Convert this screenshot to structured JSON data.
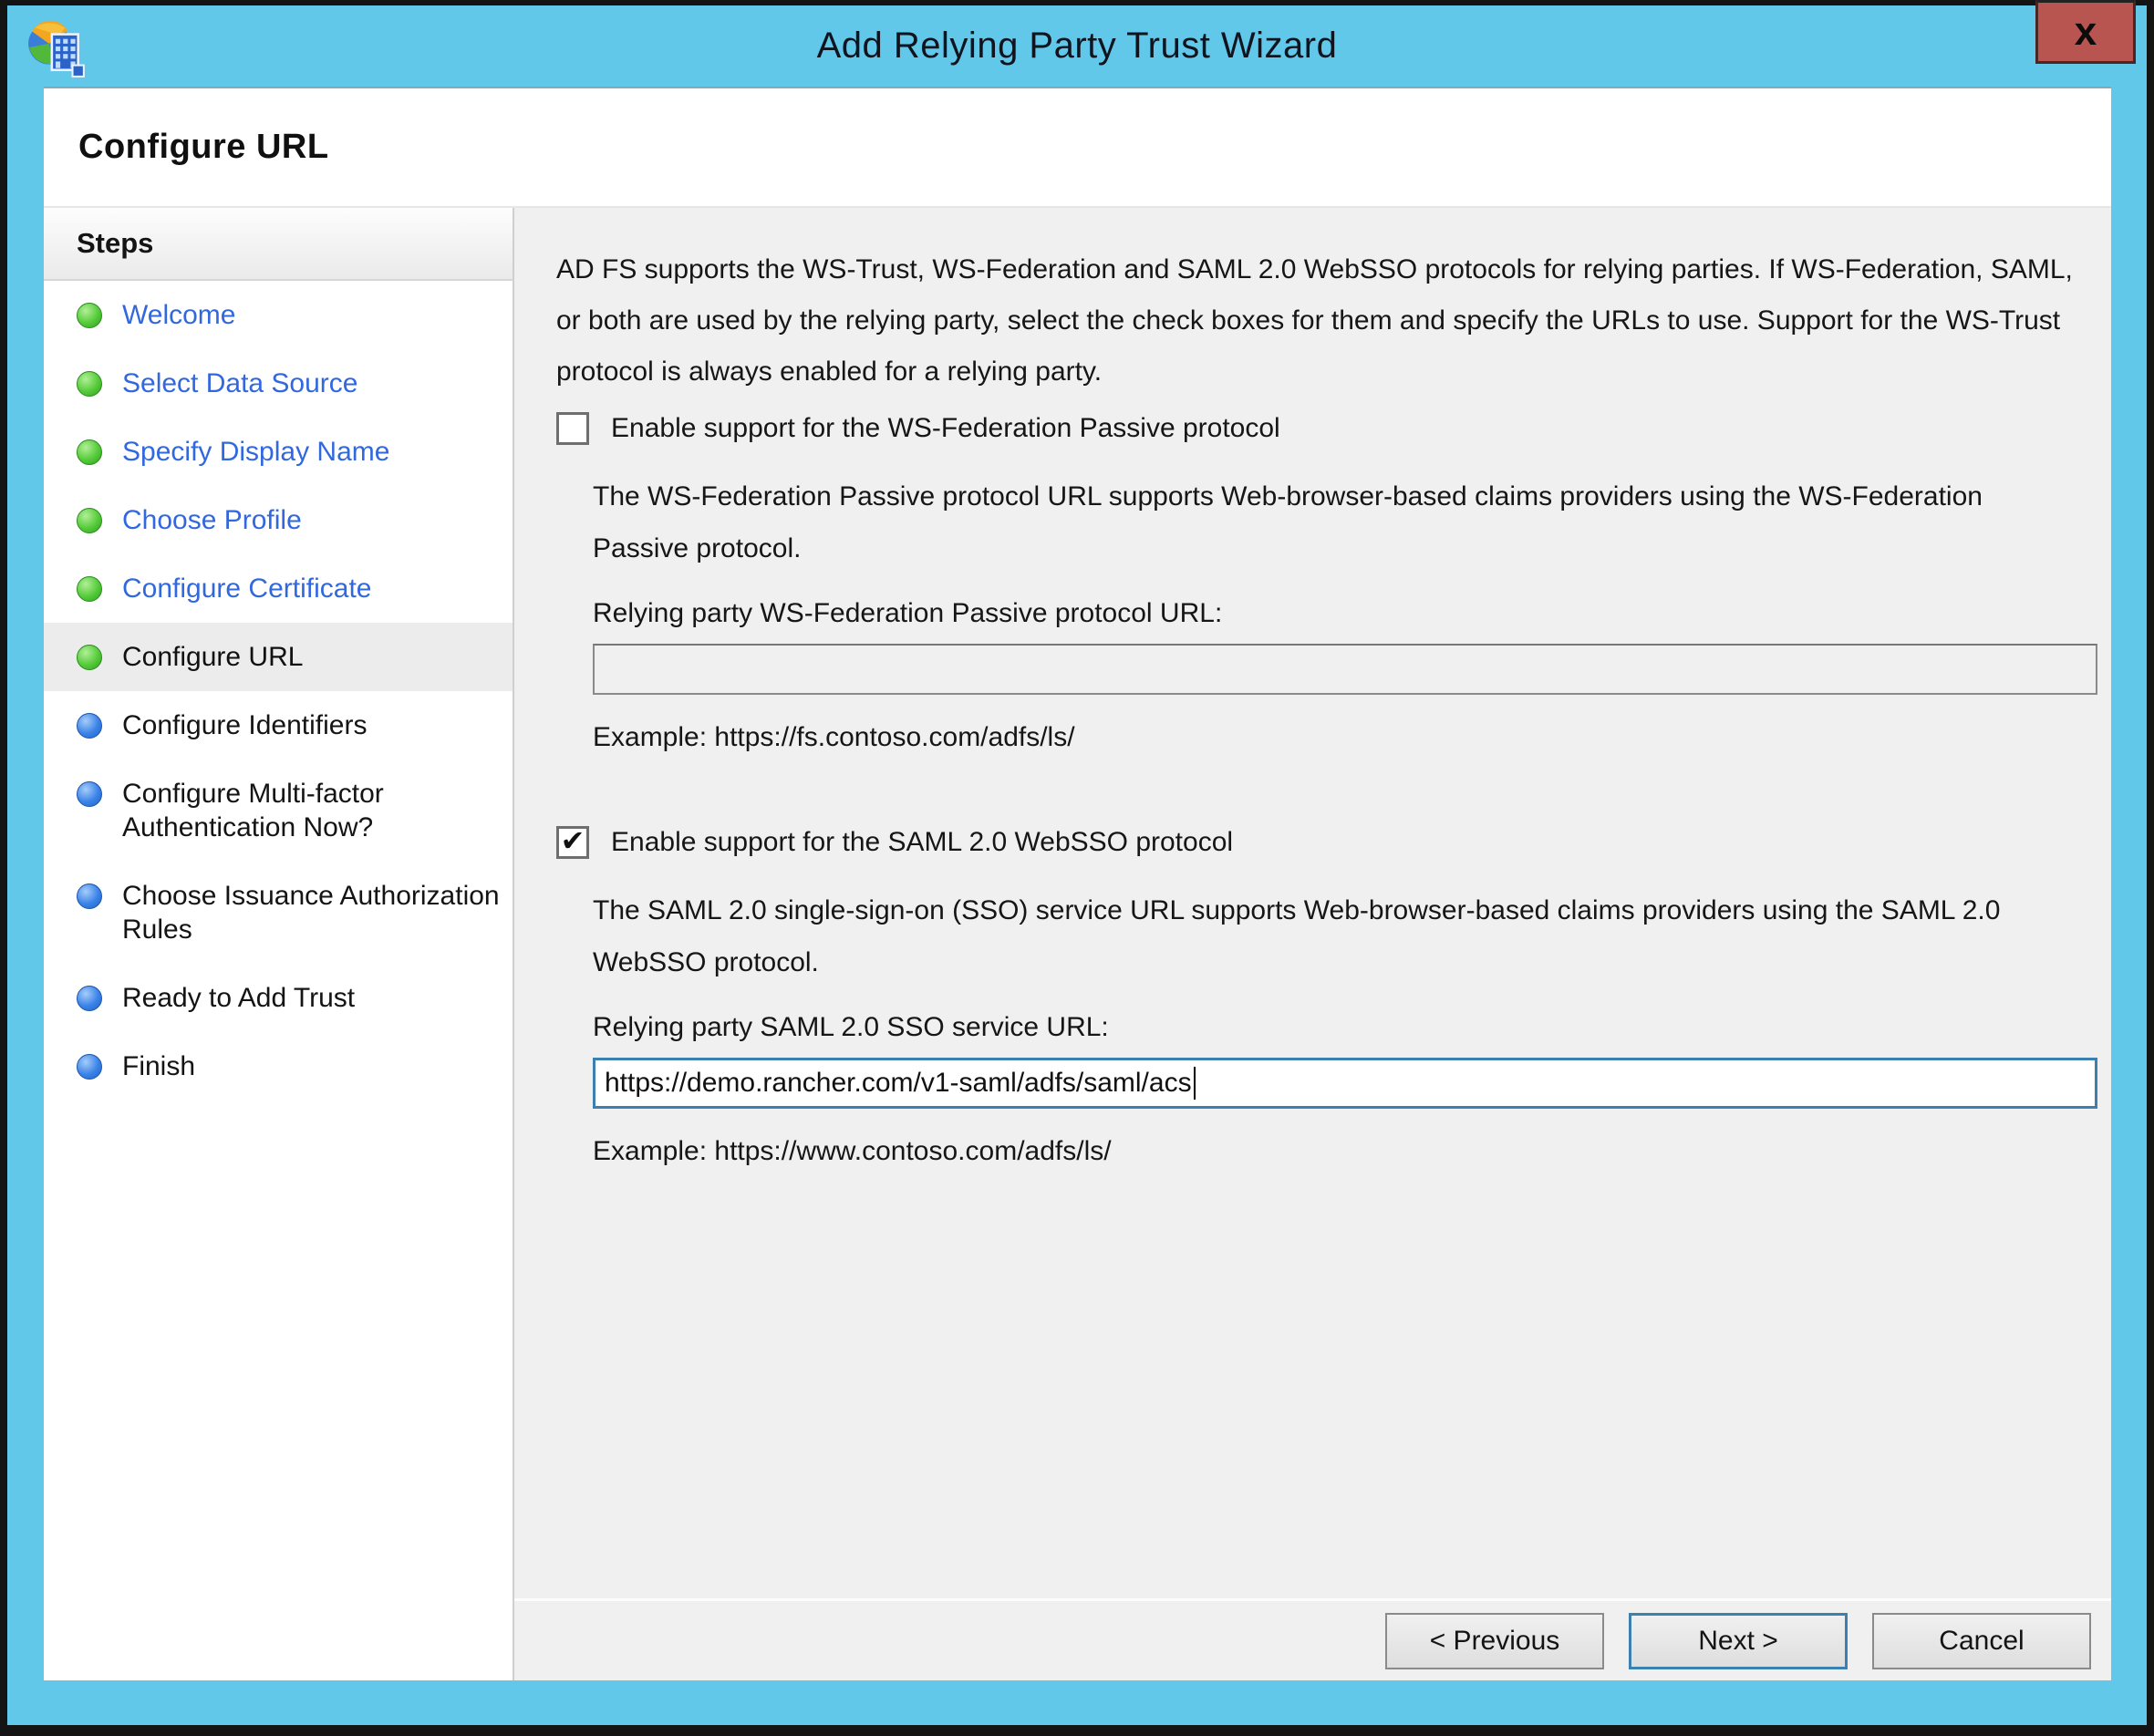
{
  "window": {
    "title": "Add Relying Party Trust Wizard",
    "page_title": "Configure URL",
    "close_label": "x"
  },
  "icons": {
    "check": "✔",
    "app_icon": "adfs-globe-building"
  },
  "steps": {
    "header": "Steps",
    "items": [
      {
        "label": "Welcome",
        "state": "done"
      },
      {
        "label": "Select Data Source",
        "state": "done"
      },
      {
        "label": "Specify Display Name",
        "state": "done"
      },
      {
        "label": "Choose Profile",
        "state": "done"
      },
      {
        "label": "Configure Certificate",
        "state": "done"
      },
      {
        "label": "Configure URL",
        "state": "current"
      },
      {
        "label": "Configure Identifiers",
        "state": "pending"
      },
      {
        "label": "Configure Multi-factor Authentication Now?",
        "state": "pending"
      },
      {
        "label": "Choose Issuance Authorization Rules",
        "state": "pending"
      },
      {
        "label": "Ready to Add Trust",
        "state": "pending"
      },
      {
        "label": "Finish",
        "state": "pending"
      }
    ]
  },
  "content": {
    "intro": "AD FS supports the WS-Trust, WS-Federation and SAML 2.0 WebSSO protocols for relying parties.  If WS-Federation, SAML, or both are used by the relying party, select the check boxes for them and specify the URLs to use.  Support for the WS-Trust protocol is always enabled for a relying party.",
    "wsfed": {
      "checkbox_label": "Enable support for the WS-Federation Passive protocol",
      "checked": false,
      "description": "The WS-Federation Passive protocol URL supports Web-browser-based claims providers using the WS-Federation Passive protocol.",
      "url_label": "Relying party WS-Federation Passive protocol URL:",
      "url_value": "",
      "example": "Example: https://fs.contoso.com/adfs/ls/"
    },
    "saml": {
      "checkbox_label": "Enable support for the SAML 2.0 WebSSO protocol",
      "checked": true,
      "description": "The SAML 2.0 single-sign-on (SSO) service URL supports Web-browser-based claims providers using the SAML 2.0 WebSSO protocol.",
      "url_label": "Relying party SAML 2.0 SSO service URL:",
      "url_value": "https://demo.rancher.com/v1-saml/adfs/saml/acs",
      "example": "Example: https://www.contoso.com/adfs/ls/"
    }
  },
  "footer": {
    "previous_label": "< Previous",
    "next_label": "Next >",
    "cancel_label": "Cancel"
  },
  "colors": {
    "titlebar_blue": "#61C8EA",
    "close_red": "#B85550",
    "link_blue": "#3268DE",
    "done_bullet_green": "#3CB52C",
    "pending_bullet_blue": "#2F7FE8",
    "focus_border_blue": "#3C7FB1",
    "pane_gray": "#F0F0F0",
    "highlight_gray": "#ECECEC"
  }
}
